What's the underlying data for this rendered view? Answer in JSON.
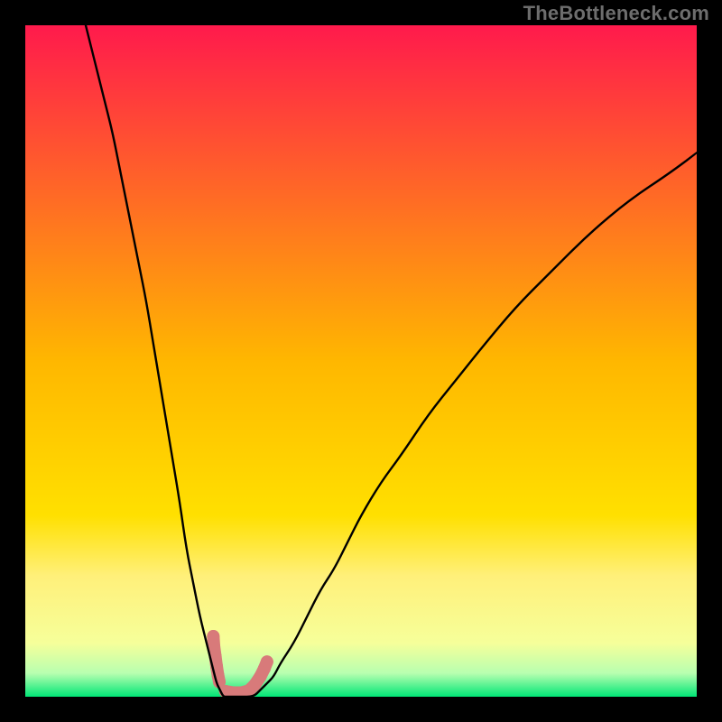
{
  "watermark": "TheBottleneck.com",
  "chart_data": {
    "type": "line",
    "title": "",
    "xlabel": "",
    "ylabel": "",
    "xlim": [
      0,
      100
    ],
    "ylim": [
      0,
      100
    ],
    "grid": false,
    "legend": false,
    "background_gradient": {
      "stops": [
        {
          "offset": 0.0,
          "color": "#ff1a4c"
        },
        {
          "offset": 0.5,
          "color": "#ffb700"
        },
        {
          "offset": 0.73,
          "color": "#ffe000"
        },
        {
          "offset": 0.82,
          "color": "#fff07a"
        },
        {
          "offset": 0.92,
          "color": "#f6ff9a"
        },
        {
          "offset": 0.965,
          "color": "#b8ffb0"
        },
        {
          "offset": 1.0,
          "color": "#00e676"
        }
      ]
    },
    "series": [
      {
        "name": "bottleneck-curve",
        "x": [
          9,
          10,
          11,
          12,
          13,
          14,
          15,
          16,
          17,
          18,
          19,
          20,
          21,
          22,
          23,
          24,
          25,
          26,
          27,
          28,
          28.5,
          29,
          29.5,
          30,
          31,
          32,
          34,
          35,
          36,
          37,
          38,
          40,
          42,
          44,
          46,
          48,
          50,
          53,
          56,
          60,
          64,
          68,
          73,
          78,
          84,
          90,
          96,
          100
        ],
        "y": [
          100,
          96,
          92,
          88,
          84,
          79,
          74,
          69,
          64,
          59,
          53,
          47,
          41,
          35,
          29,
          22,
          17,
          12,
          8,
          4,
          2,
          1,
          0,
          0,
          0,
          0,
          0,
          1,
          2,
          3,
          5,
          8,
          12,
          16,
          19,
          23,
          27,
          32,
          36,
          42,
          47,
          52,
          58,
          63,
          69,
          74,
          78,
          81
        ]
      }
    ],
    "highlights": [
      {
        "name": "low-region-marker-left",
        "color": "#d87a7a",
        "points": [
          [
            28.0,
            9
          ],
          [
            28.1,
            7.5
          ],
          [
            28.3,
            6
          ],
          [
            28.5,
            4.5
          ],
          [
            28.7,
            3.2
          ],
          [
            28.9,
            2.2
          ]
        ]
      },
      {
        "name": "low-region-marker-right",
        "color": "#d87a7a",
        "points": [
          [
            29.8,
            0.8
          ],
          [
            31.0,
            0.6
          ],
          [
            32.2,
            0.6
          ],
          [
            33.3,
            0.9
          ],
          [
            34.2,
            1.8
          ],
          [
            35.0,
            3.0
          ],
          [
            35.6,
            4.2
          ],
          [
            36.0,
            5.2
          ]
        ]
      }
    ]
  }
}
